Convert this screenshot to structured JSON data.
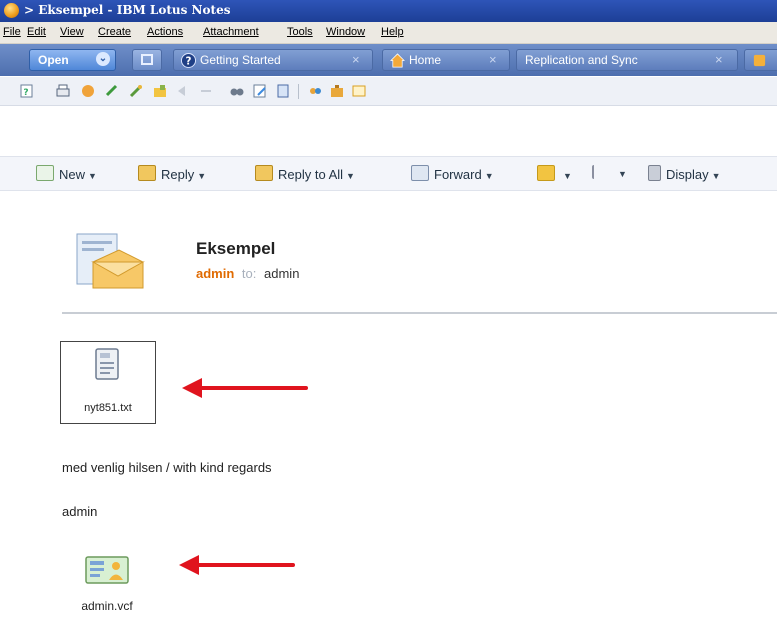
{
  "window": {
    "title": "> Eksempel - IBM Lotus Notes"
  },
  "menu": [
    "File",
    "Edit",
    "View",
    "Create",
    "Actions",
    "Attachment",
    "Tools",
    "Window",
    "Help"
  ],
  "tabs": {
    "open_label": "Open",
    "items": [
      {
        "label": "Getting Started",
        "icon": "help-icon"
      },
      {
        "label": "Home",
        "icon": "home-icon"
      },
      {
        "label": "Replication and Sync",
        "icon": ""
      }
    ]
  },
  "actions": {
    "new": "New",
    "reply": "Reply",
    "reply_all": "Reply to All",
    "forward": "Forward",
    "display": "Display"
  },
  "message": {
    "subject": "Eksempel",
    "from": "admin",
    "to_word": "to:",
    "recipient": "admin",
    "body": "med venlig hilsen / with kind regards",
    "signature": "admin",
    "attachments": [
      {
        "name": "nyt851.txt",
        "icon": "text-file-icon"
      },
      {
        "name": "admin.vcf",
        "icon": "vcard-icon"
      }
    ]
  },
  "colors": {
    "title_bar": "#2e55b8",
    "tab_bar": "#5d7dbc",
    "sender": "#e06a00",
    "arrow": "#e0141e"
  }
}
